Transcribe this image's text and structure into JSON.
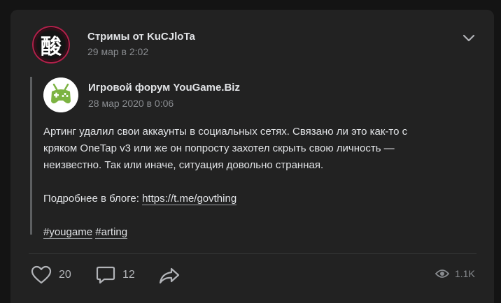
{
  "post": {
    "author": "Стримы от KuCJloTa",
    "date": "29 мар в 2:02",
    "avatar_glyph": "酸",
    "menu_icon": "chevron-down-icon"
  },
  "repost": {
    "author": "Игровой форум YouGame.Biz",
    "date": "28 мар 2020 в 0:06",
    "avatar_icon": "gamepad-icon",
    "text_line1": "Артинг удалил свои аккаунты в социальных сетях. Связано ли это как-то с",
    "text_line2": "кряком OneTap v3 или же он попросту захотел скрыть свою личность —",
    "text_line3": "неизвестно. Так или иначе, ситуация довольно странная.",
    "more_prefix": "Подробнее в блоге: ",
    "more_link": "https://t.me/govthing",
    "tag1": "#yougame",
    "tag2": "#arting"
  },
  "actions": {
    "likes": "20",
    "comments": "12",
    "views": "1.1K"
  },
  "colors": {
    "background": "#141414",
    "card": "#222222",
    "text": "#e1e3e6",
    "muted": "#8a8d91",
    "gamepad_green": "#7cb342"
  }
}
